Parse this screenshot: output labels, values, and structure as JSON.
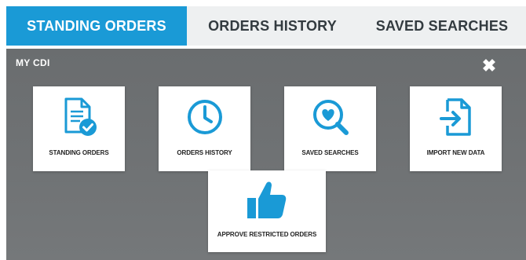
{
  "tabs": [
    {
      "label": "STANDING ORDERS",
      "active": true
    },
    {
      "label": "ORDERS HISTORY",
      "active": false
    },
    {
      "label": "SAVED SEARCHES",
      "active": false
    }
  ],
  "overlay": {
    "title": "MY CDI",
    "close_icon": "close-icon",
    "close_glyph": "✖"
  },
  "tiles": [
    {
      "label": "STANDING ORDERS",
      "icon": "document-check-icon"
    },
    {
      "label": "ORDERS HISTORY",
      "icon": "clock-icon"
    },
    {
      "label": "SAVED SEARCHES",
      "icon": "heart-search-icon"
    },
    {
      "label": "IMPORT NEW DATA",
      "icon": "file-import-icon"
    },
    {
      "label": "APPROVE RESTRICTED ORDERS",
      "icon": "thumbs-up-icon"
    }
  ],
  "colors": {
    "accent": "#1a9ad6",
    "tab_inactive_bg": "#eef0f1",
    "overlay_bg": "#6e7173"
  }
}
